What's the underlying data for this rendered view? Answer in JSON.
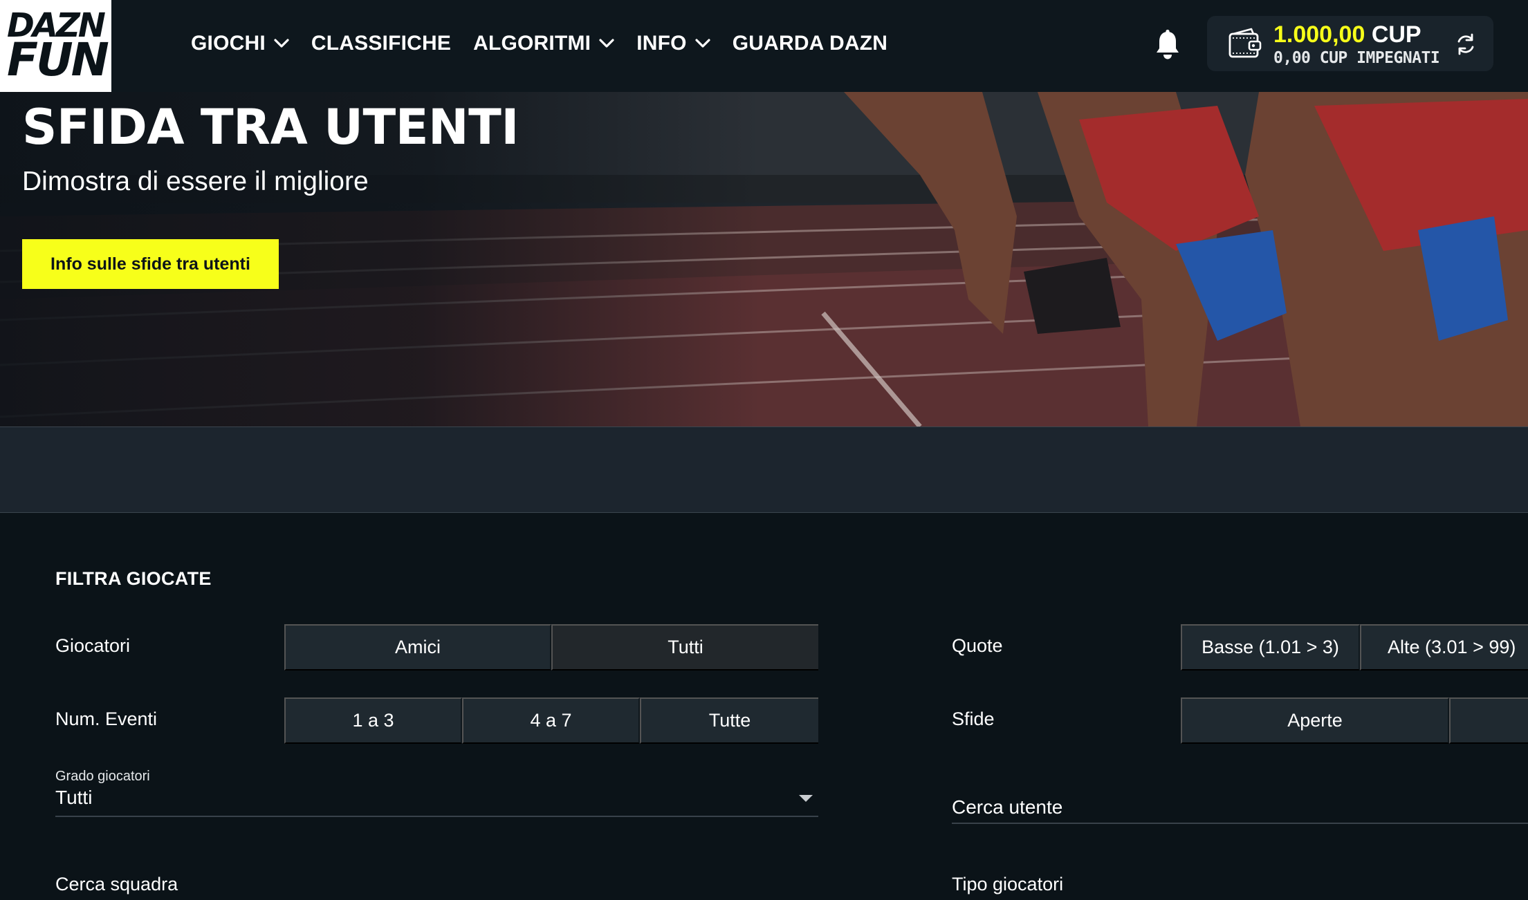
{
  "header": {
    "logo": {
      "line1": "DAZN",
      "line2": "FUN"
    },
    "nav": [
      {
        "label": "GIOCHI",
        "has_dropdown": true
      },
      {
        "label": "CLASSIFICHE",
        "has_dropdown": false
      },
      {
        "label": "ALGORITMI",
        "has_dropdown": true
      },
      {
        "label": "INFO",
        "has_dropdown": true
      },
      {
        "label": "GUARDA DAZN",
        "has_dropdown": false
      }
    ],
    "wallet": {
      "amount": "1.000,00",
      "currency": "CUP",
      "committed": "0,00 CUP IMPEGNATI"
    },
    "icons": {
      "notifications": "bell-icon",
      "wallet": "wallet-icon",
      "refresh": "refresh-icon",
      "dropdown": "chevron-down-icon"
    }
  },
  "hero": {
    "title": "SFIDA TRA UTENTI",
    "subtitle": "Dimostra di essere il migliore",
    "cta_label": "Info sulle sfide tra utenti"
  },
  "filters": {
    "title": "FILTRA GIOCATE",
    "giocatori": {
      "label": "Giocatori",
      "options": [
        "Amici",
        "Tutti"
      ],
      "selected": "Tutti"
    },
    "quote": {
      "label": "Quote",
      "options": [
        "Basse (1.01 > 3)",
        "Alte (3.01 > 99)"
      ]
    },
    "num_eventi": {
      "label": "Num. Eventi",
      "options": [
        "1 a 3",
        "4 a 7",
        "Tutte"
      ]
    },
    "sfide": {
      "label": "Sfide",
      "options": [
        "Aperte",
        ""
      ]
    },
    "grado": {
      "label": "Grado giocatori",
      "value": "Tutti"
    },
    "cerca_utente": {
      "placeholder": "Cerca utente"
    },
    "cerca_squadra": {
      "label": "Cerca squadra"
    },
    "tipo_giocatori": {
      "label": "Tipo giocatori"
    }
  },
  "colors": {
    "accent_yellow": "#f7ff1a",
    "header_bg": "#0e171d",
    "page_bg": "#0b1318",
    "segment_bg": "#1f2930"
  }
}
